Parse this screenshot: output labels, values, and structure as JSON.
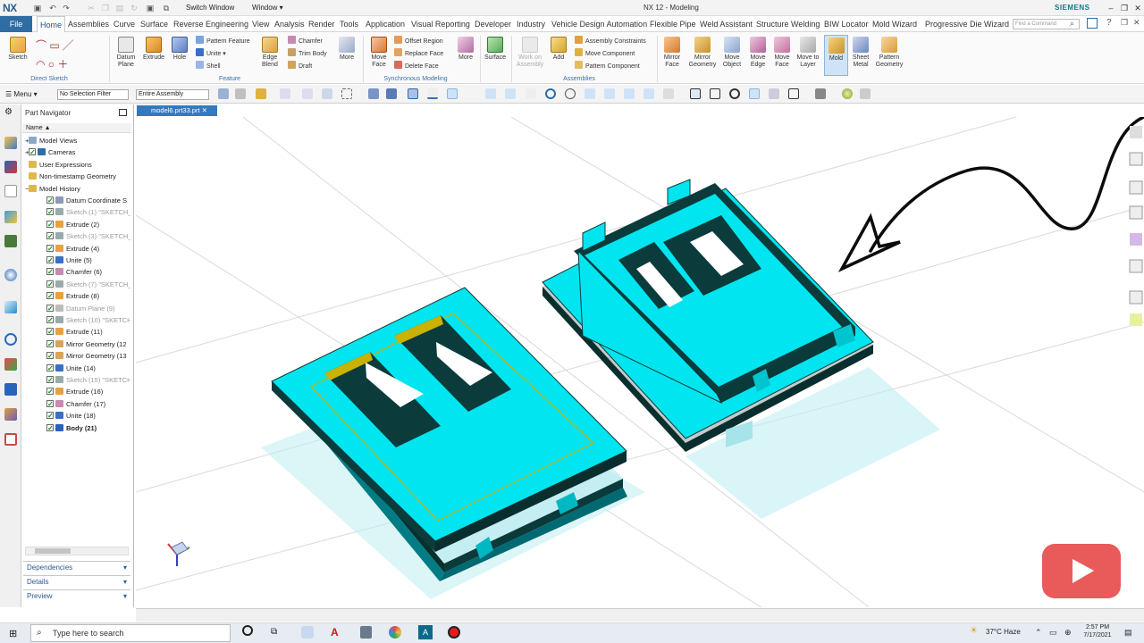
{
  "app": {
    "logo": "NX",
    "title": "NX 12 - Modeling",
    "brand": "SIEMENS"
  },
  "quick_access": {
    "switch_window": "Switch Window",
    "window": "Window"
  },
  "menu": {
    "file": "File",
    "tabs": [
      "Home",
      "Assemblies",
      "Curve",
      "Surface",
      "Reverse Engineering",
      "View",
      "Analysis",
      "Render",
      "Tools",
      "Application",
      "Visual Reporting",
      "Developer",
      "Industry",
      "Vehicle Design Automation",
      "Flexible Pipe",
      "Weld Assistant",
      "Structure Welding",
      "BIW Locator",
      "Mold Wizard",
      "Progressive Die Wizard"
    ],
    "search_placeholder": "Find a Command"
  },
  "ribbon": {
    "direct_sketch": {
      "label": "Direct Sketch",
      "sketch": "Sketch"
    },
    "feature": {
      "label": "Feature",
      "datum_plane": "Datum Plane",
      "extrude": "Extrude",
      "hole": "Hole",
      "pattern_feature": "Pattern Feature",
      "unite": "Unite",
      "shell": "Shell",
      "edge_blend": "Edge Blend",
      "chamfer": "Chamfer",
      "trim_body": "Trim Body",
      "draft": "Draft",
      "more": "More"
    },
    "sync": {
      "label": "Synchronous Modeling",
      "move_face": "Move Face",
      "offset_region": "Offset Region",
      "replace_face": "Replace Face",
      "delete_face": "Delete Face",
      "more": "More"
    },
    "surface": "Surface",
    "assemblies": {
      "label": "Assemblies",
      "work_on_assembly": "Work on Assembly",
      "add": "Add",
      "assembly_constraints": "Assembly Constraints",
      "move_component": "Move Component",
      "pattern_component": "Pattern Component"
    },
    "tools": {
      "mirror_face": "Mirror Face",
      "mirror_geometry": "Mirror Geometry",
      "move_object": "Move Object",
      "move_edge": "Move Edge",
      "move_face": "Move Face",
      "move_to_layer": "Move to Layer",
      "mold": "Mold",
      "sheet_metal": "Sheet Metal",
      "pattern_geometry": "Pattern Geometry"
    }
  },
  "toolbar": {
    "menu": "Menu",
    "selection_filter": "No Selection Filter",
    "scope": "Entire Assembly"
  },
  "navigator": {
    "title": "Part Navigator",
    "column": "Name",
    "items": [
      {
        "label": "Model Views",
        "style": "node"
      },
      {
        "label": "Cameras",
        "style": "node"
      },
      {
        "label": "User Expressions",
        "style": "folder"
      },
      {
        "label": "Non-timestamp Geometry",
        "style": "folder"
      },
      {
        "label": "Model History",
        "style": "folder"
      },
      {
        "label": "Datum Coordinate S",
        "style": "normal"
      },
      {
        "label": "Sketch (1) \"SKETCH_",
        "style": "gray"
      },
      {
        "label": "Extrude (2)",
        "style": "normal"
      },
      {
        "label": "Sketch (3) \"SKETCH_",
        "style": "gray"
      },
      {
        "label": "Extrude (4)",
        "style": "normal"
      },
      {
        "label": "Unite (5)",
        "style": "normal"
      },
      {
        "label": "Chamfer (6)",
        "style": "normal"
      },
      {
        "label": "Sketch (7) \"SKETCH_",
        "style": "gray"
      },
      {
        "label": "Extrude (8)",
        "style": "normal"
      },
      {
        "label": "Datum Plane (9)",
        "style": "gray"
      },
      {
        "label": "Sketch (10) \"SKETCH",
        "style": "gray"
      },
      {
        "label": "Extrude (11)",
        "style": "normal"
      },
      {
        "label": "Mirror Geometry (12",
        "style": "normal"
      },
      {
        "label": "Mirror Geometry (13",
        "style": "normal"
      },
      {
        "label": "Unite (14)",
        "style": "normal"
      },
      {
        "label": "Sketch (15) \"SKETCH",
        "style": "gray"
      },
      {
        "label": "Extrude (16)",
        "style": "normal"
      },
      {
        "label": "Chamfer (17)",
        "style": "normal"
      },
      {
        "label": "Unite (18)",
        "style": "normal"
      },
      {
        "label": "Body (21)",
        "style": "bold"
      }
    ],
    "panels": [
      "Dependencies",
      "Details",
      "Preview"
    ]
  },
  "document_tab": "model6.prt33.prt",
  "taskbar": {
    "search": "Type here to search",
    "weather": "37°C  Haze",
    "time": "2:57 PM",
    "date": "7/17/2021"
  },
  "colors": {
    "model": "#00e5ef",
    "model_dark": "#0b3b3b",
    "accent": "#2e6da4",
    "chamfer": "#c9b200"
  }
}
